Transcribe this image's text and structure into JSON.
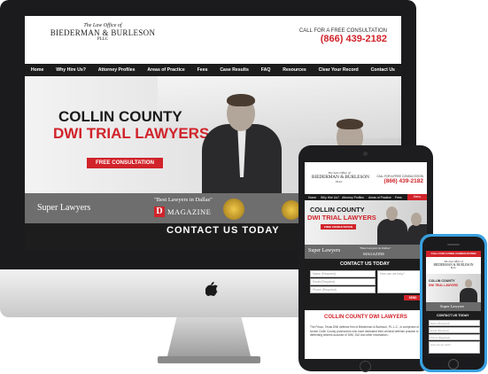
{
  "site": {
    "logo_top": "The Law Office of",
    "logo_main": "BIEDERMAN & BURLESON",
    "logo_sub": "PLLC",
    "call_label": "CALL FOR A FREE CONSULTATION",
    "phone": "(866) 439-2182",
    "nav": [
      "Home",
      "Why Hire Us?",
      "Attorney Profiles",
      "Areas of Practice",
      "Fees",
      "Case Results",
      "FAQ",
      "Resources",
      "Clear Your Record",
      "Contact Us"
    ],
    "hero_line1": "COLLIN COUNTY",
    "hero_line2": "DWI TRIAL LAWYERS",
    "cta_button": "FREE CONSULTATION",
    "super_lawyers": "Super Lawyers",
    "best_lawyers": "\"Best Lawyers in Dallas\"",
    "magazine_letter": "D",
    "magazine_word": "MAGAZINE",
    "contact_today": "CONTACT US TODAY"
  },
  "tablet": {
    "logo_top": "The Law Office of",
    "logo_main": "BIEDERMAN & BURLESON",
    "logo_sub": "PLLC",
    "call_label": "CALL FOR A FREE CONSULTATION",
    "phone": "(866) 439-2182",
    "nav": [
      "Home",
      "Why Hire Us?",
      "Attorney Profiles",
      "Areas of Practice",
      "Fees"
    ],
    "menu_label": "Menu",
    "hero_line1": "COLLIN COUNTY",
    "hero_line2": "DWI TRIAL LAWYERS",
    "cta_button": "FREE CONSULTATION",
    "super_lawyers": "Super Lawyers",
    "best_lawyers": "\"Best Lawyers in Dallas\"",
    "magazine_word": "MAGAZINE",
    "contact_today": "CONTACT US TODAY",
    "field_name": "Name (Required)",
    "field_email": "Email (Required)",
    "field_phone": "Phone (Required)",
    "field_how": "How can we help?",
    "send_label": "SEND",
    "section_title": "COLLIN COUNTY DWI LAWYERS",
    "body_text": "The Frisco, Texas DWI defense firm of Biederman & Burleson, P.L.L.C., is comprised of former Collin County prosecutors who have dedicated their criminal defense practice to defending citizens accused of DWI, DUI and other intoxication..."
  },
  "phone_device": {
    "call_label": "CALL FOR A FREE CONSULTATION",
    "logo_top": "The Law Office of",
    "logo_main": "BIEDERMAN & BURLESON",
    "logo_sub": "PLLC",
    "hero_line1": "COLLIN COUNTY",
    "hero_line2": "DWI TRIAL LAWYERS",
    "super_lawyers": "Super Lawyers",
    "contact_today": "CONTACT US TODAY",
    "field_name": "Name (Required)",
    "field_email": "Email (Required)",
    "field_phone": "Phone (Required)",
    "field_how": "How can we help?"
  },
  "colors": {
    "accent_red": "#d1232a",
    "nav_dark": "#1c1c1c",
    "phone_blue": "#3aa0df"
  }
}
